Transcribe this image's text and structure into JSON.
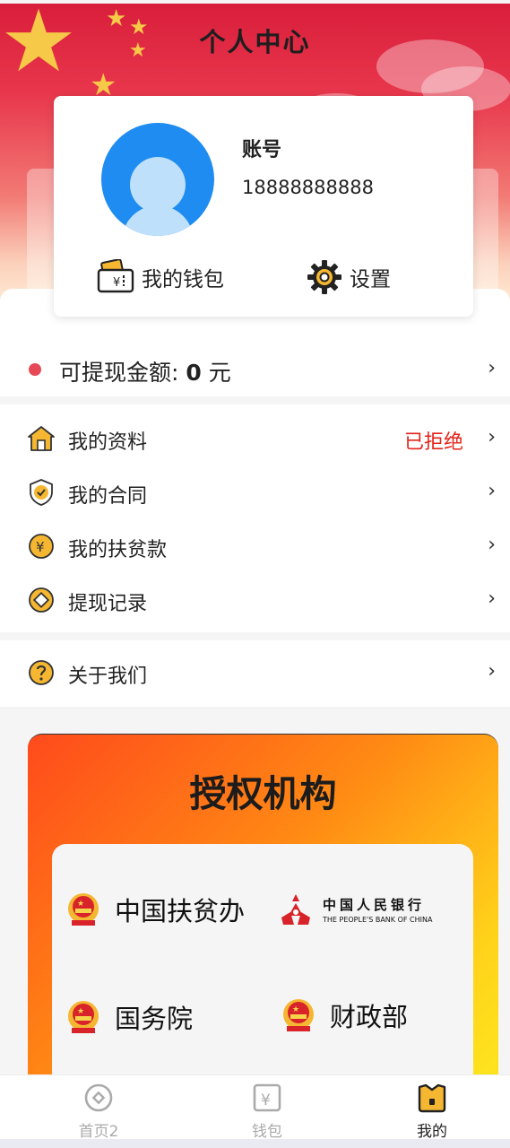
{
  "header": {
    "title": "个人中心"
  },
  "profile": {
    "account_label": "账号",
    "account_number": "18888888888",
    "wallet_label": "我的钱包",
    "settings_label": "设置"
  },
  "balance": {
    "label": "可提现金额: ",
    "amount": "0",
    "unit": " 元"
  },
  "menu": {
    "items": [
      {
        "label": "我的资料",
        "status": "已拒绝",
        "icon": "house-icon"
      },
      {
        "label": "我的合同",
        "status": "",
        "icon": "shield-check-icon"
      },
      {
        "label": "我的扶贫款",
        "status": "",
        "icon": "yuan-coin-icon"
      },
      {
        "label": "提现记录",
        "status": "",
        "icon": "diamond-coin-icon"
      }
    ],
    "about": {
      "label": "关于我们",
      "icon": "question-icon"
    }
  },
  "auth": {
    "title": "授权机构",
    "orgs": [
      {
        "name": "中国扶贫办",
        "icon": "national-emblem-icon"
      },
      {
        "name_cn": "中国人民银行",
        "name_en": "THE PEOPLE'S BANK OF CHINA",
        "icon": "pboc-logo-icon"
      },
      {
        "name": "国务院",
        "icon": "national-emblem-icon"
      },
      {
        "name": "财政部",
        "icon": "national-emblem-icon"
      }
    ]
  },
  "tabbar": {
    "tabs": [
      {
        "label": "首页2",
        "icon": "home-coin-icon",
        "active": false
      },
      {
        "label": "钱包",
        "icon": "wallet-yuan-icon",
        "active": false
      },
      {
        "label": "我的",
        "icon": "profile-icon",
        "active": true
      }
    ]
  },
  "colors": {
    "accent_red": "#e3241b",
    "dot_red": "#e74856",
    "avatar_blue": "#1e8cf1",
    "gold": "#f5b731"
  }
}
